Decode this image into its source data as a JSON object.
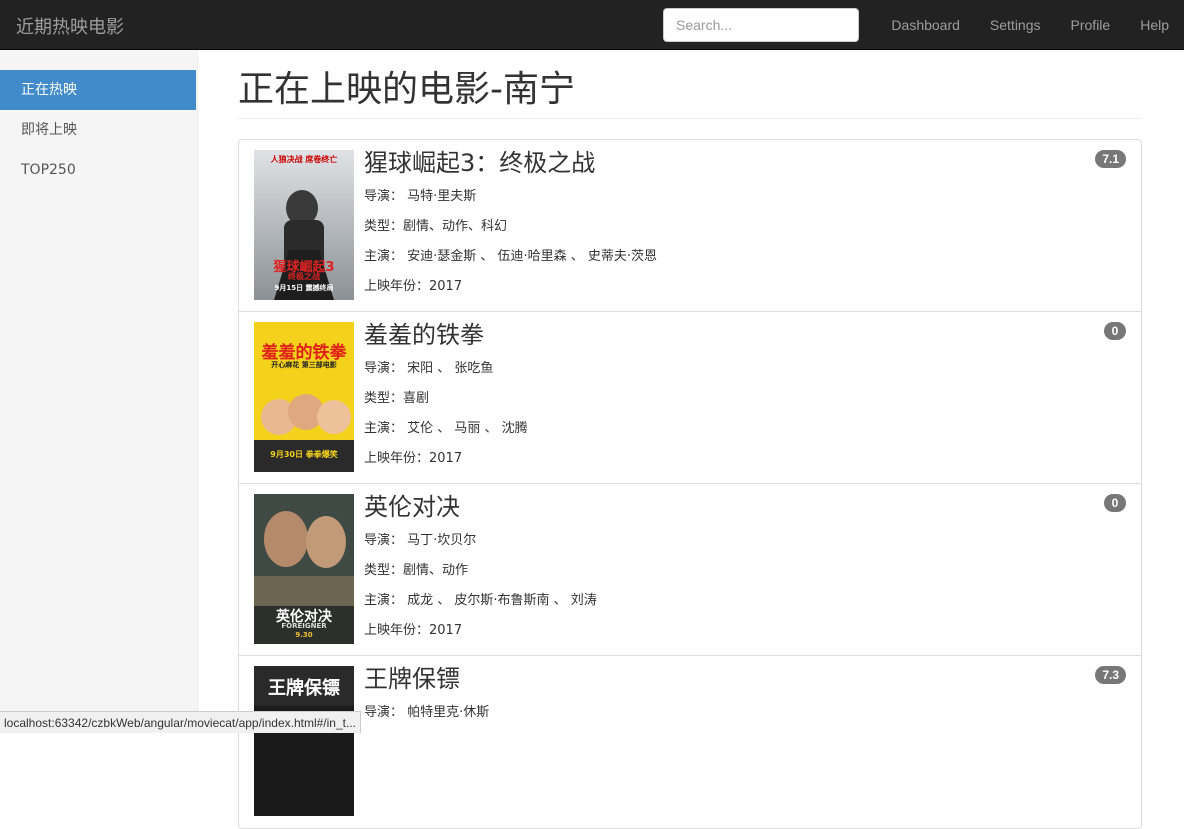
{
  "navbar": {
    "brand": "近期热映电影",
    "search_placeholder": "Search...",
    "links": [
      "Dashboard",
      "Settings",
      "Profile",
      "Help"
    ]
  },
  "sidebar": {
    "items": [
      {
        "label": "正在热映",
        "active": true
      },
      {
        "label": "即将上映",
        "active": false
      },
      {
        "label": "TOP250",
        "active": false
      }
    ]
  },
  "main": {
    "title": "正在上映的电影-南宁",
    "movies": [
      {
        "title": "猩球崛起3：终极之战",
        "director": "导演： 马特·里夫斯",
        "genre": "类型：剧情、动作、科幻",
        "cast": "主演： 安迪·瑟金斯 、 伍迪·哈里森 、 史蒂夫·茨恩",
        "year": "上映年份：2017",
        "rating": "7.1",
        "poster": {
          "top": "人狼决战 席卷终亡",
          "main": "猩球崛起3",
          "sub": "终极之战",
          "date": "9月15日 震撼终局"
        }
      },
      {
        "title": "羞羞的铁拳",
        "director": "导演： 宋阳 、 张吃鱼",
        "genre": "类型：喜剧",
        "cast": "主演： 艾伦 、 马丽 、 沈腾",
        "year": "上映年份：2017",
        "rating": "0",
        "poster": {
          "top": "",
          "main": "羞羞的铁拳",
          "sub": "开心麻花 第三部电影",
          "date": "9月30日 拳拳爆笑"
        }
      },
      {
        "title": "英伦对决",
        "director": "导演： 马丁·坎贝尔",
        "genre": "类型：剧情、动作",
        "cast": "主演： 成龙 、 皮尔斯·布鲁斯南 、 刘涛",
        "year": "上映年份：2017",
        "rating": "0",
        "poster": {
          "top": "",
          "main": "英伦对决",
          "sub": "FOREIGNER",
          "date": "9.30"
        }
      },
      {
        "title": "王牌保镖",
        "director": "导演： 帕特里克·休斯",
        "genre": "",
        "cast": "",
        "year": "",
        "rating": "7.3",
        "poster": {
          "top": "",
          "main": "王牌保镖",
          "sub": "",
          "date": ""
        }
      }
    ]
  },
  "statusbar": {
    "url": "localhost:63342/czbkWeb/angular/moviecat/app/index.html#/in_t..."
  },
  "colors": {
    "navbar": "#222222",
    "sidebar_active": "#428bca",
    "badge": "#777777"
  }
}
